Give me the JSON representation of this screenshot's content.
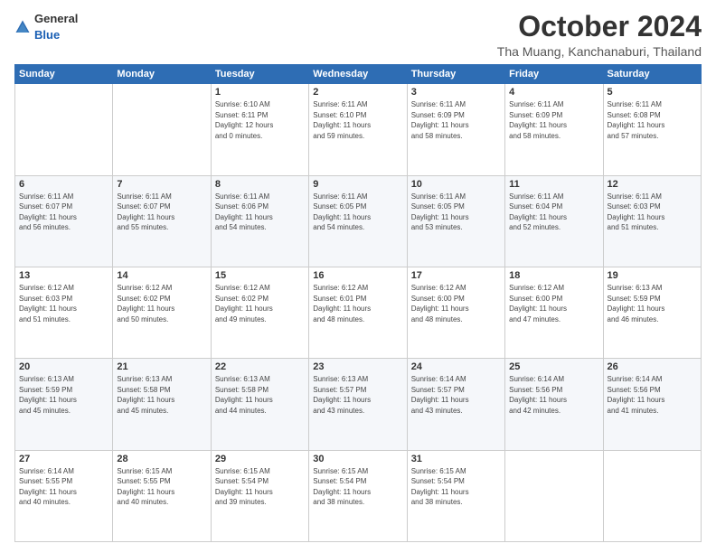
{
  "header": {
    "logo": {
      "general": "General",
      "blue": "Blue"
    },
    "title": "October 2024",
    "subtitle": "Tha Muang, Kanchanaburi, Thailand"
  },
  "calendar": {
    "headers": [
      "Sunday",
      "Monday",
      "Tuesday",
      "Wednesday",
      "Thursday",
      "Friday",
      "Saturday"
    ],
    "rows": [
      [
        {
          "day": "",
          "info": ""
        },
        {
          "day": "",
          "info": ""
        },
        {
          "day": "1",
          "info": "Sunrise: 6:10 AM\nSunset: 6:11 PM\nDaylight: 12 hours\nand 0 minutes."
        },
        {
          "day": "2",
          "info": "Sunrise: 6:11 AM\nSunset: 6:10 PM\nDaylight: 11 hours\nand 59 minutes."
        },
        {
          "day": "3",
          "info": "Sunrise: 6:11 AM\nSunset: 6:09 PM\nDaylight: 11 hours\nand 58 minutes."
        },
        {
          "day": "4",
          "info": "Sunrise: 6:11 AM\nSunset: 6:09 PM\nDaylight: 11 hours\nand 58 minutes."
        },
        {
          "day": "5",
          "info": "Sunrise: 6:11 AM\nSunset: 6:08 PM\nDaylight: 11 hours\nand 57 minutes."
        }
      ],
      [
        {
          "day": "6",
          "info": "Sunrise: 6:11 AM\nSunset: 6:07 PM\nDaylight: 11 hours\nand 56 minutes."
        },
        {
          "day": "7",
          "info": "Sunrise: 6:11 AM\nSunset: 6:07 PM\nDaylight: 11 hours\nand 55 minutes."
        },
        {
          "day": "8",
          "info": "Sunrise: 6:11 AM\nSunset: 6:06 PM\nDaylight: 11 hours\nand 54 minutes."
        },
        {
          "day": "9",
          "info": "Sunrise: 6:11 AM\nSunset: 6:05 PM\nDaylight: 11 hours\nand 54 minutes."
        },
        {
          "day": "10",
          "info": "Sunrise: 6:11 AM\nSunset: 6:05 PM\nDaylight: 11 hours\nand 53 minutes."
        },
        {
          "day": "11",
          "info": "Sunrise: 6:11 AM\nSunset: 6:04 PM\nDaylight: 11 hours\nand 52 minutes."
        },
        {
          "day": "12",
          "info": "Sunrise: 6:11 AM\nSunset: 6:03 PM\nDaylight: 11 hours\nand 51 minutes."
        }
      ],
      [
        {
          "day": "13",
          "info": "Sunrise: 6:12 AM\nSunset: 6:03 PM\nDaylight: 11 hours\nand 51 minutes."
        },
        {
          "day": "14",
          "info": "Sunrise: 6:12 AM\nSunset: 6:02 PM\nDaylight: 11 hours\nand 50 minutes."
        },
        {
          "day": "15",
          "info": "Sunrise: 6:12 AM\nSunset: 6:02 PM\nDaylight: 11 hours\nand 49 minutes."
        },
        {
          "day": "16",
          "info": "Sunrise: 6:12 AM\nSunset: 6:01 PM\nDaylight: 11 hours\nand 48 minutes."
        },
        {
          "day": "17",
          "info": "Sunrise: 6:12 AM\nSunset: 6:00 PM\nDaylight: 11 hours\nand 48 minutes."
        },
        {
          "day": "18",
          "info": "Sunrise: 6:12 AM\nSunset: 6:00 PM\nDaylight: 11 hours\nand 47 minutes."
        },
        {
          "day": "19",
          "info": "Sunrise: 6:13 AM\nSunset: 5:59 PM\nDaylight: 11 hours\nand 46 minutes."
        }
      ],
      [
        {
          "day": "20",
          "info": "Sunrise: 6:13 AM\nSunset: 5:59 PM\nDaylight: 11 hours\nand 45 minutes."
        },
        {
          "day": "21",
          "info": "Sunrise: 6:13 AM\nSunset: 5:58 PM\nDaylight: 11 hours\nand 45 minutes."
        },
        {
          "day": "22",
          "info": "Sunrise: 6:13 AM\nSunset: 5:58 PM\nDaylight: 11 hours\nand 44 minutes."
        },
        {
          "day": "23",
          "info": "Sunrise: 6:13 AM\nSunset: 5:57 PM\nDaylight: 11 hours\nand 43 minutes."
        },
        {
          "day": "24",
          "info": "Sunrise: 6:14 AM\nSunset: 5:57 PM\nDaylight: 11 hours\nand 43 minutes."
        },
        {
          "day": "25",
          "info": "Sunrise: 6:14 AM\nSunset: 5:56 PM\nDaylight: 11 hours\nand 42 minutes."
        },
        {
          "day": "26",
          "info": "Sunrise: 6:14 AM\nSunset: 5:56 PM\nDaylight: 11 hours\nand 41 minutes."
        }
      ],
      [
        {
          "day": "27",
          "info": "Sunrise: 6:14 AM\nSunset: 5:55 PM\nDaylight: 11 hours\nand 40 minutes."
        },
        {
          "day": "28",
          "info": "Sunrise: 6:15 AM\nSunset: 5:55 PM\nDaylight: 11 hours\nand 40 minutes."
        },
        {
          "day": "29",
          "info": "Sunrise: 6:15 AM\nSunset: 5:54 PM\nDaylight: 11 hours\nand 39 minutes."
        },
        {
          "day": "30",
          "info": "Sunrise: 6:15 AM\nSunset: 5:54 PM\nDaylight: 11 hours\nand 38 minutes."
        },
        {
          "day": "31",
          "info": "Sunrise: 6:15 AM\nSunset: 5:54 PM\nDaylight: 11 hours\nand 38 minutes."
        },
        {
          "day": "",
          "info": ""
        },
        {
          "day": "",
          "info": ""
        }
      ]
    ]
  }
}
